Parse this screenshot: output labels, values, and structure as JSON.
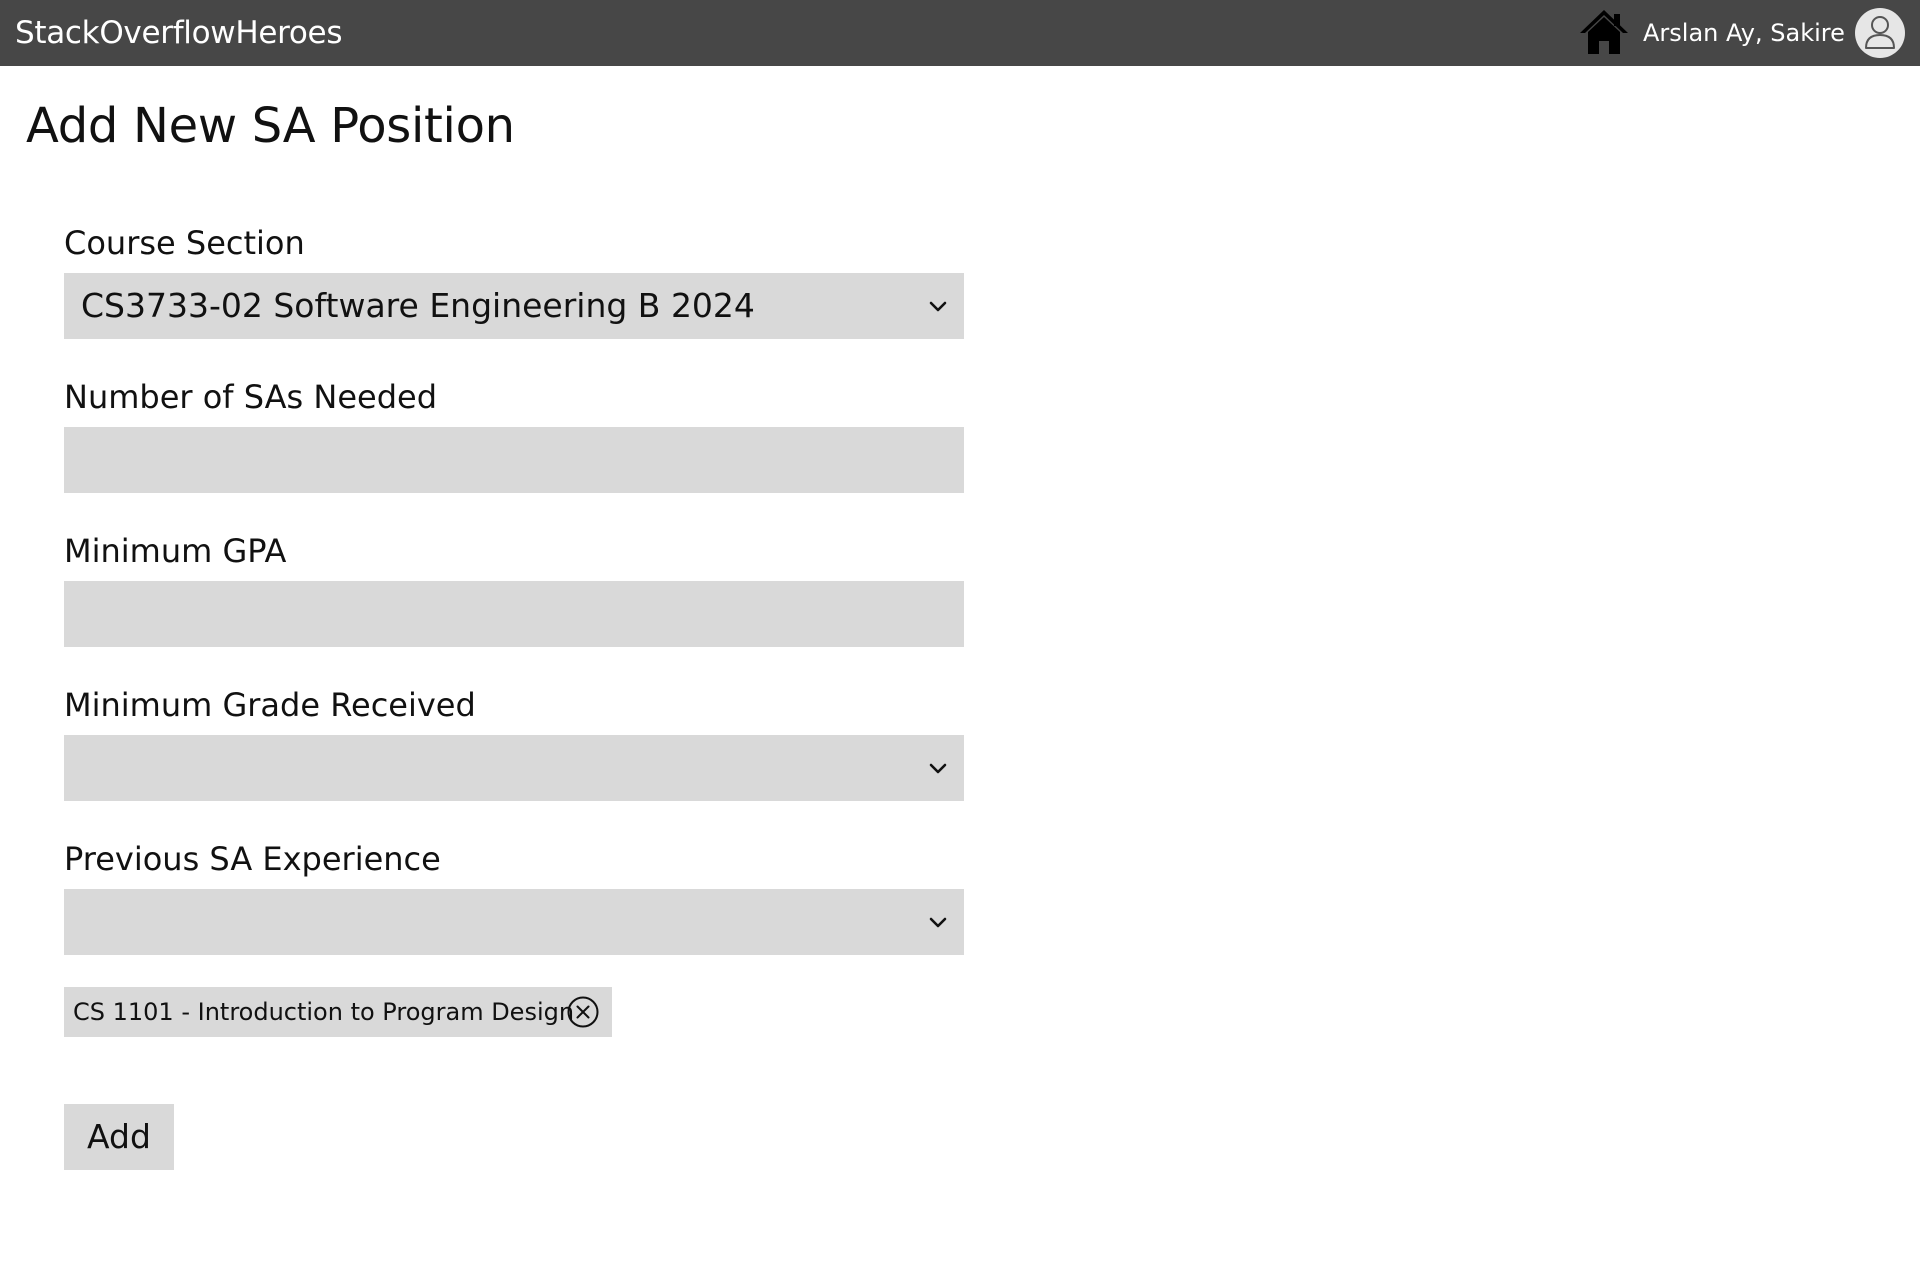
{
  "app": {
    "brand": "StackOverflowHeroes",
    "home_icon": "home-icon",
    "user_name": "Arslan Ay, Sakire",
    "avatar_icon": "user-avatar-icon",
    "colors": {
      "topbar": "#474747",
      "field_bg": "#d9d9d9",
      "text": "#111111"
    }
  },
  "page": {
    "title": "Add New SA Position"
  },
  "form": {
    "course_section": {
      "label": "Course Section",
      "value": "CS3733-02 Software Engineering B 2024"
    },
    "num_sas": {
      "label": "Number of SAs Needed",
      "value": ""
    },
    "min_gpa": {
      "label": "Minimum GPA",
      "value": ""
    },
    "min_grade": {
      "label": "Minimum Grade Received",
      "value": ""
    },
    "prev_experience": {
      "label": "Previous SA Experience",
      "value": "",
      "selected_chips": [
        {
          "label": "CS 1101 - Introduction to Program Design",
          "remove_icon": "close-circle-icon"
        }
      ]
    },
    "submit_label": "Add"
  }
}
